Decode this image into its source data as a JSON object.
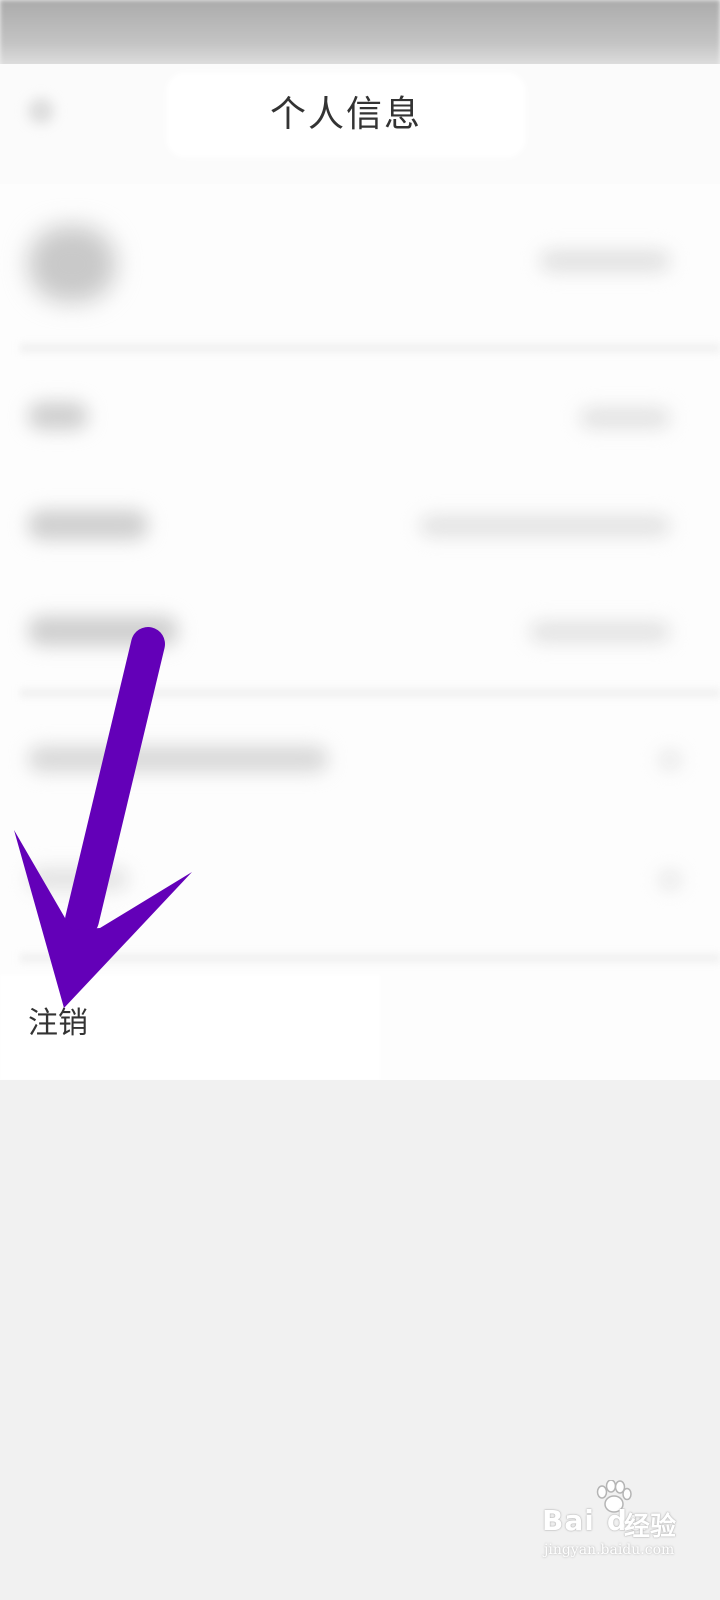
{
  "header": {
    "title": "个人信息"
  },
  "menu": {
    "logout_label": "注销"
  },
  "annotation": {
    "arrow_color": "#6300b8"
  },
  "watermark": {
    "brand": "Bai",
    "brand_suffix": "du",
    "product": "经验",
    "url": "jingyan.baidu.com"
  },
  "colors": {
    "page_background": "#f2f2f2",
    "content_background": "#fdfdfd",
    "title_text": "#333333"
  }
}
